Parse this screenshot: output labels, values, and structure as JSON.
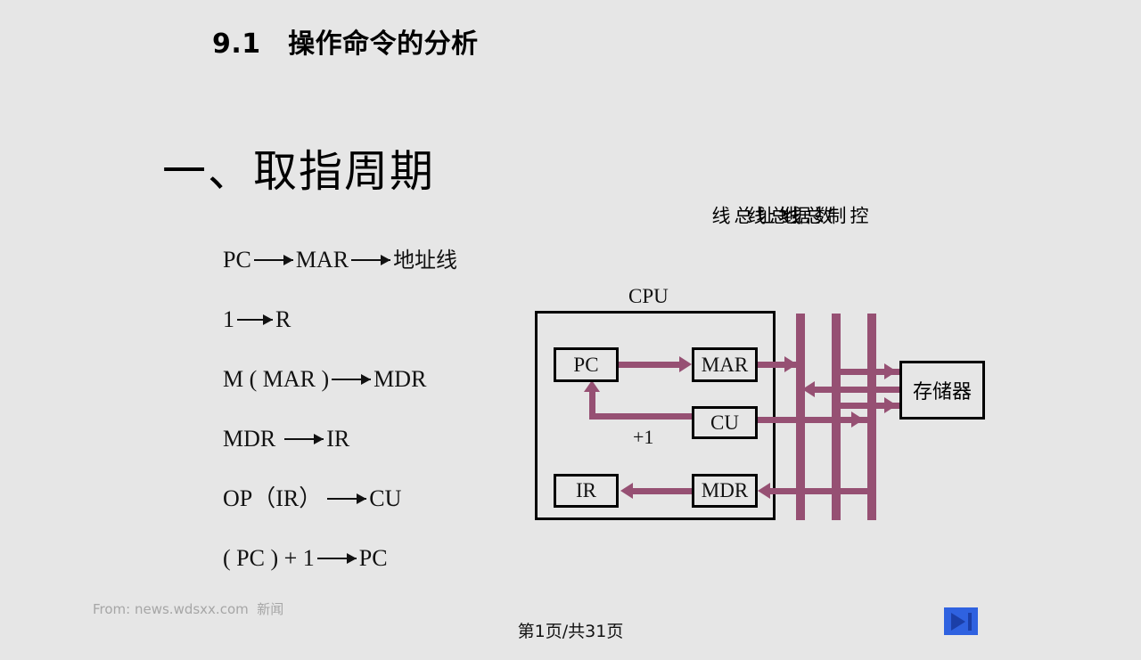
{
  "slide": {
    "background_color": "#e6e6e6",
    "title": "9.1　操作命令的分析",
    "section_heading": "一、取指周期",
    "accent_color": "#965073",
    "formulas": [
      {
        "lhs": "PC",
        "rhs": "MAR",
        "tail": "地址线"
      },
      {
        "lhs": "1",
        "rhs": "R",
        "tail": ""
      },
      {
        "lhs": "M ( MAR )",
        "rhs": "MDR",
        "tail": ""
      },
      {
        "lhs": "MDR",
        "rhs": "IR",
        "tail": ""
      },
      {
        "lhs": "OP（IR）",
        "rhs": "CU",
        "tail": ""
      },
      {
        "lhs": "( PC ) + 1",
        "rhs": "PC",
        "tail": ""
      }
    ]
  },
  "diagram": {
    "cpu_caption": "CPU",
    "increment_label": "+1",
    "memory_label": "存储器",
    "units": [
      {
        "id": "pc",
        "label": "PC"
      },
      {
        "id": "mar",
        "label": "MAR"
      },
      {
        "id": "cu",
        "label": "CU"
      },
      {
        "id": "ir",
        "label": "IR"
      },
      {
        "id": "mdr",
        "label": "MDR"
      }
    ],
    "bus_labels": [
      {
        "id": "address-bus",
        "label": "地址总线"
      },
      {
        "id": "data-bus",
        "label": "数据总线"
      },
      {
        "id": "control-bus",
        "label": "控制总线"
      }
    ]
  },
  "footer": {
    "source": "From: news.wdsxx.com  新闻",
    "page_indicator": "第1页/共31页",
    "next_button_icon": "skip-next-icon"
  }
}
